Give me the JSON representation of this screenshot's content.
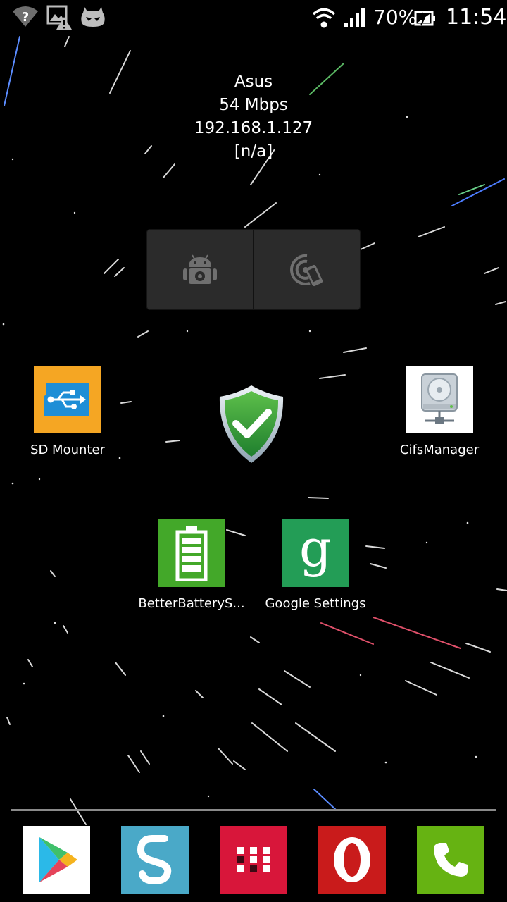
{
  "status_bar": {
    "battery_percent": "70%",
    "time": "11:54",
    "icons": [
      "wifi-question-icon",
      "image-warning-icon",
      "cyanogen-mascot-icon",
      "wifi-signal-icon",
      "cell-signal-icon",
      "battery-charging-icon"
    ]
  },
  "wifi_widget": {
    "network": "Asus",
    "speed": "54 Mbps",
    "ip": "192.168.1.127",
    "extra": "[n/a]"
  },
  "toggle_widget": {
    "buttons": [
      "android-settings-icon",
      "nfc-phone-icon"
    ]
  },
  "apps": [
    {
      "label": "SD Mounter",
      "icon": "usb-sd-card-icon",
      "color": "#f5a623"
    },
    {
      "label": "CifsManager",
      "icon": "network-drive-icon",
      "color": "#ffffff"
    },
    {
      "label": "BetterBatteryS...",
      "icon": "battery-icon",
      "color": "#43a829"
    },
    {
      "label": "Google Settings",
      "icon": "google-g-icon",
      "color": "#239d56"
    }
  ],
  "shield_widget": {
    "icon": "security-shield-check-icon",
    "color": "#3da53c"
  },
  "dock": [
    {
      "name": "play-store",
      "icon": "play-store-icon",
      "color": "#ffffff"
    },
    {
      "name": "swiftkey",
      "icon": "swiftkey-icon",
      "color": "#4aa9c8"
    },
    {
      "name": "app-drawer",
      "icon": "app-drawer-grid-icon",
      "color": "#d8163a"
    },
    {
      "name": "opera",
      "icon": "opera-icon",
      "color": "#c91b1b"
    },
    {
      "name": "phone",
      "icon": "phone-icon",
      "color": "#66b312"
    }
  ]
}
